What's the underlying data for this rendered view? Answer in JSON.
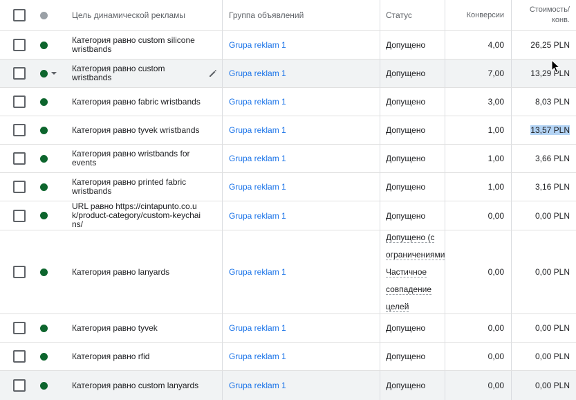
{
  "header": {
    "target": "Цель динамической рекламы",
    "group": "Группа объявлений",
    "status": "Статус",
    "conversions": "Конверсии",
    "cost_line1": "Стоимость/",
    "cost_line2": "конв."
  },
  "colors": {
    "enabled_dot": "#0d652d",
    "link": "#1a73e8",
    "row_alt": "#f1f3f4"
  },
  "rows": [
    {
      "target": "Категория равно custom silicone wristbands",
      "group": "Grupa reklam 1",
      "status": "Допущено",
      "conversions": "4,00",
      "cost": "26,25 PLN"
    },
    {
      "target": "Категория равно custom wristbands",
      "group": "Grupa reklam 1",
      "status": "Допущено",
      "conversions": "7,00",
      "cost": "13,29 PLN"
    },
    {
      "target": "Категория равно fabric wristbands",
      "group": "Grupa reklam 1",
      "status": "Допущено",
      "conversions": "3,00",
      "cost": "8,03 PLN"
    },
    {
      "target": "Категория равно tyvek wristbands",
      "group": "Grupa reklam 1",
      "status": "Допущено",
      "conversions": "1,00",
      "cost": "13,57 PLN"
    },
    {
      "target": "Категория равно wristbands for events",
      "group": "Grupa reklam 1",
      "status": "Допущено",
      "conversions": "1,00",
      "cost": "3,66 PLN"
    },
    {
      "target": "Категория равно printed fabric wristbands",
      "group": "Grupa reklam 1",
      "status": "Допущено",
      "conversions": "1,00",
      "cost": "3,16 PLN"
    },
    {
      "target": "URL равно https://cintapunto.co.uk/product-category/custom-keychains/",
      "group": "Grupa reklam 1",
      "status": "Допущено",
      "conversions": "0,00",
      "cost": "0,00 PLN"
    },
    {
      "target": "Категория равно lanyards",
      "group": "Grupa reklam 1",
      "status_lines": [
        "Допущено (с",
        "ограничениями",
        "Частичное",
        "совпадение",
        "целей"
      ],
      "conversions": "0,00",
      "cost": "0,00 PLN"
    },
    {
      "target": "Категория равно tyvek",
      "group": "Grupa reklam 1",
      "status": "Допущено",
      "conversions": "0,00",
      "cost": "0,00 PLN"
    },
    {
      "target": "Категория равно rfid",
      "group": "Grupa reklam 1",
      "status": "Допущено",
      "conversions": "0,00",
      "cost": "0,00 PLN"
    },
    {
      "target": "Категория равно custom lanyards",
      "group": "Grupa reklam 1",
      "status": "Допущено",
      "conversions": "0,00",
      "cost": "0,00 PLN"
    }
  ]
}
